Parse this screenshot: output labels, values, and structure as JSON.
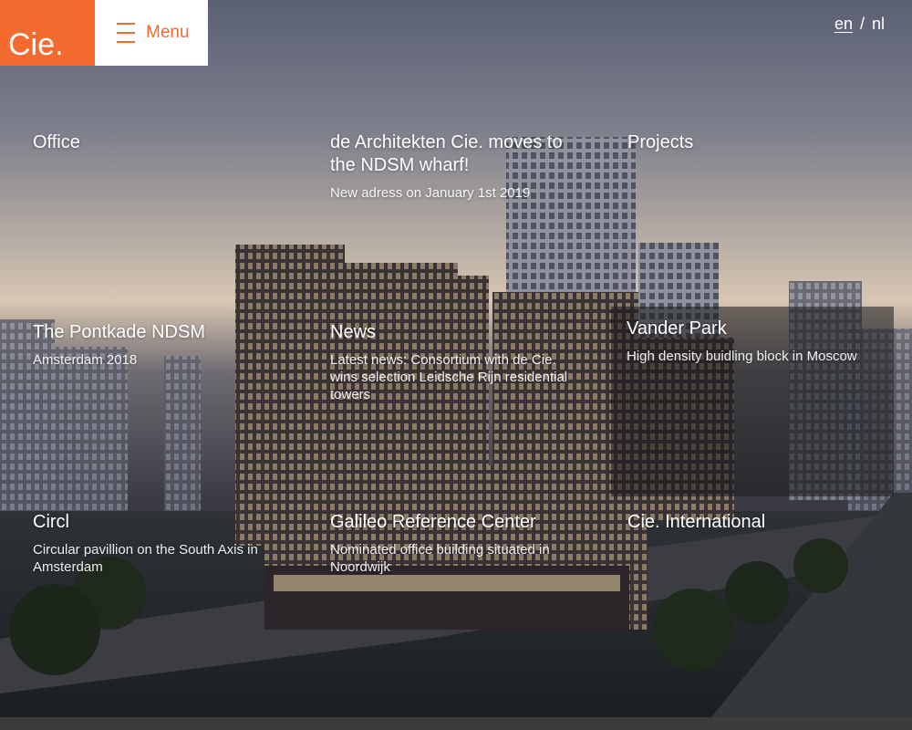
{
  "brand": {
    "logo_text": "Cie.",
    "accent": "#f26a2e"
  },
  "menu": {
    "label": "Menu",
    "icon": "hamburger-icon"
  },
  "language": {
    "options": [
      "en",
      "nl"
    ],
    "active": "en",
    "separator": "/"
  },
  "tiles": [
    {
      "title": "Office",
      "subtitle": ""
    },
    {
      "title": "de Architekten Cie. moves to the NDSM wharf!",
      "subtitle": "New adress on January 1st 2019"
    },
    {
      "title": "Projects",
      "subtitle": ""
    },
    {
      "title": "The Pontkade NDSM",
      "subtitle": "Amsterdam 2018"
    },
    {
      "title": "News",
      "subtitle": "Latest news: Consortium with de Cie. wins selection Leidsche Rijn residential towers"
    },
    {
      "title": "Vander Park",
      "subtitle": "High density buidling block in Moscow"
    },
    {
      "title": "Circl",
      "subtitle": "Circular pavillion on the South Axis in Amsterdam"
    },
    {
      "title": "Galileo Reference Center",
      "subtitle": "Nominated office building situated in Noordwijk"
    },
    {
      "title": "Cie. International",
      "subtitle": ""
    }
  ]
}
